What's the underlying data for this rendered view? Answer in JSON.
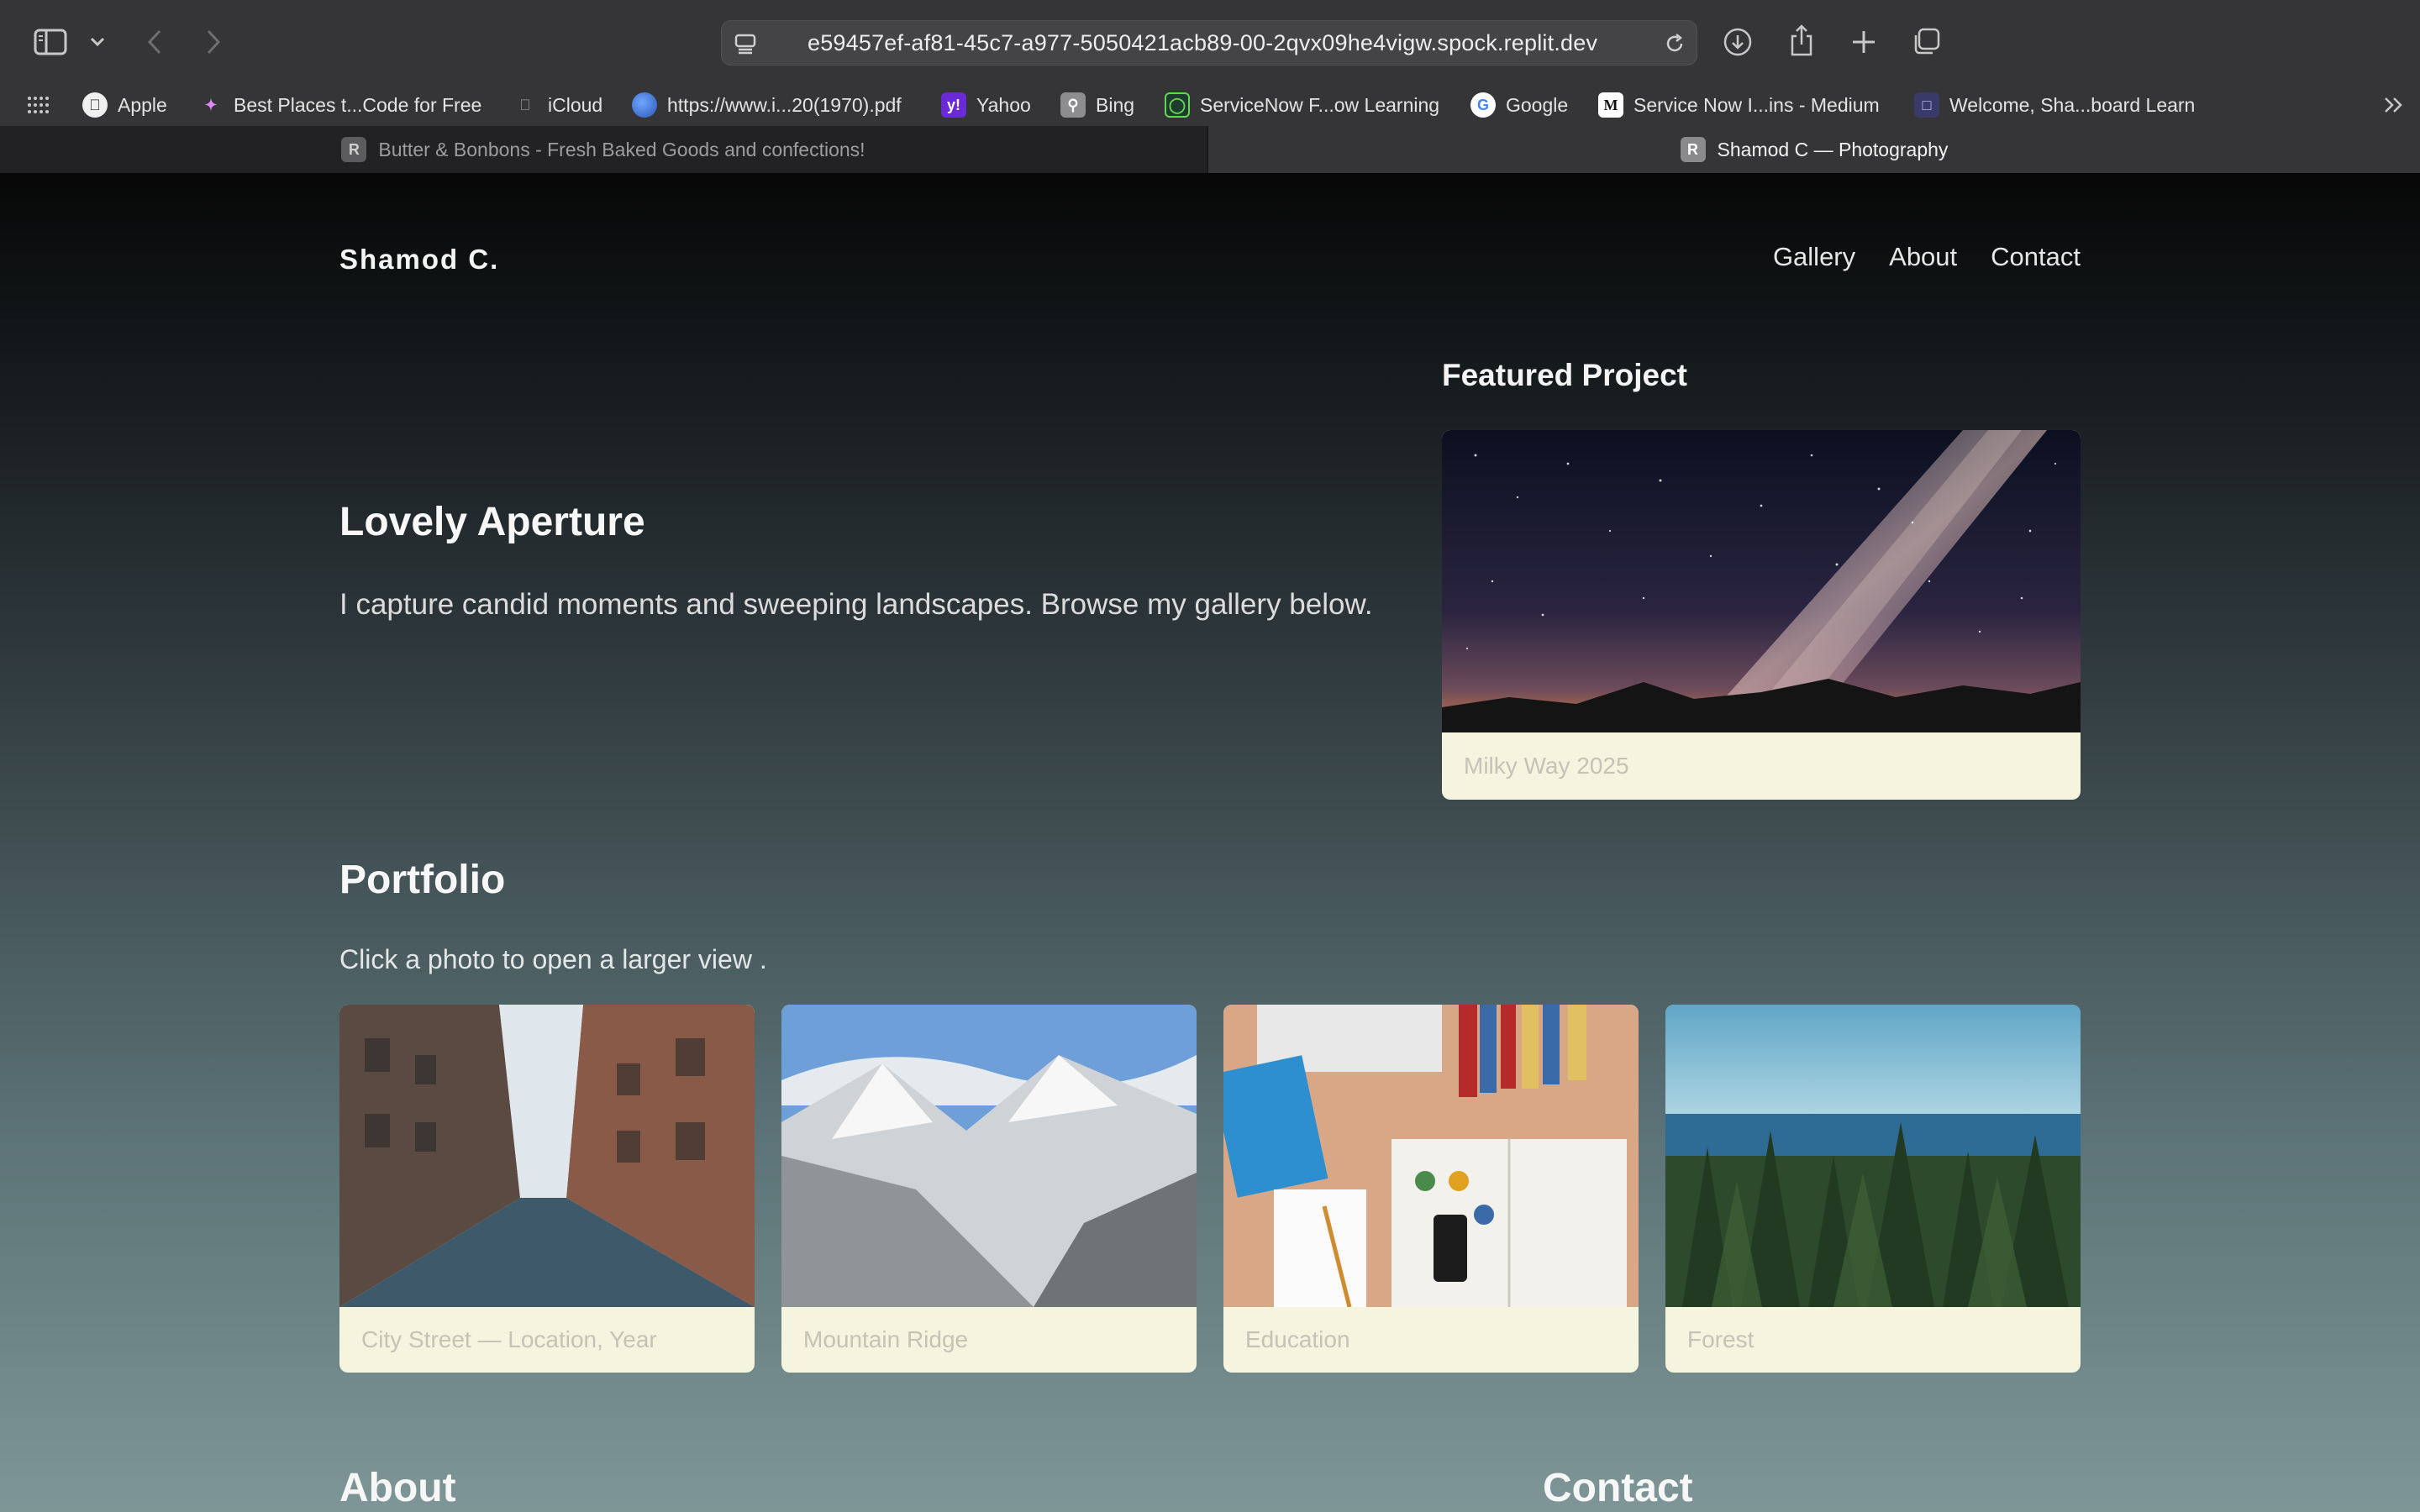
{
  "browser": {
    "url": "e59457ef-af81-45c7-a977-5050421acb89-00-2qvx09he4vigw.spock.replit.dev",
    "bookmarks": [
      {
        "label": "Apple",
        "icon": "apple-icon"
      },
      {
        "label": "Best Places t...Code for Free",
        "icon": "sparkle-icon"
      },
      {
        "label": "iCloud",
        "icon": "apple-icon"
      },
      {
        "label": "https://www.i...20(1970).pdf",
        "icon": "globe-icon"
      },
      {
        "label": "Yahoo",
        "icon": "yahoo-icon"
      },
      {
        "label": "Bing",
        "icon": "bing-icon"
      },
      {
        "label": "ServiceNow F...ow Learning",
        "icon": "servicenow-icon"
      },
      {
        "label": "Google",
        "icon": "google-icon"
      },
      {
        "label": "Service Now I...ins - Medium",
        "icon": "medium-icon"
      },
      {
        "label": "Welcome, Sha...board Learn",
        "icon": "blackboard-icon"
      }
    ],
    "tabs": [
      {
        "label": "Butter & Bonbons - Fresh Baked Goods and confections!",
        "favicon": "R",
        "active": false
      },
      {
        "label": "Shamod C — Photography",
        "favicon": "R",
        "active": true
      }
    ]
  },
  "site": {
    "brand": "Shamod C.",
    "nav": [
      "Gallery",
      "About",
      "Contact"
    ],
    "hero": {
      "title": "Lovely Aperture",
      "subtitle": "I capture candid moments and sweeping landscapes. Browse my gallery below."
    },
    "featured": {
      "heading": "Featured Project",
      "caption": "Milky Way 2025"
    },
    "portfolio": {
      "heading": "Portfolio",
      "subtitle": "Click a photo to open a larger view .",
      "items": [
        {
          "caption": "City Street — Location, Year"
        },
        {
          "caption": "Mountain Ridge"
        },
        {
          "caption": "Education"
        },
        {
          "caption": "Forest"
        }
      ]
    },
    "about_heading": "About",
    "contact_heading": "Contact"
  },
  "colors": {
    "chrome": "#353537",
    "card_caption_bg": "#f5f4df",
    "caption_text": "#c4c3b5"
  }
}
